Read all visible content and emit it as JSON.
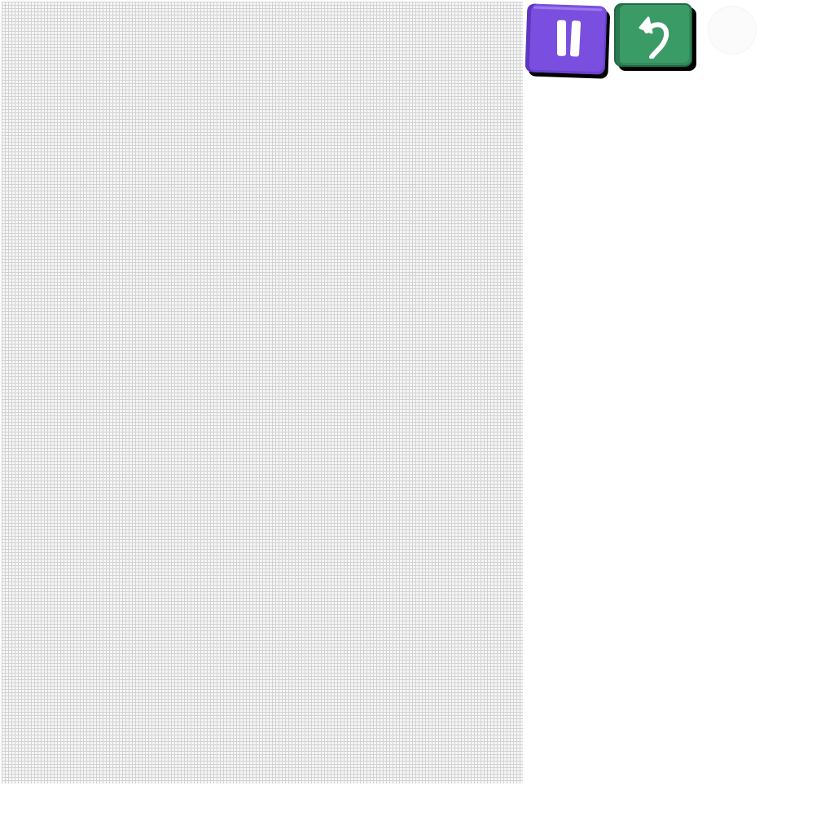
{
  "game": {
    "board": {
      "pattern": "grid",
      "background_color": "#f6f6f6",
      "line_color": "#d2d2d2"
    },
    "controls": {
      "pause": {
        "icon": "pause-icon",
        "color": "#7a4fe0"
      },
      "undo": {
        "icon": "undo-arrow-icon",
        "color": "#3a9b66"
      },
      "extra": {
        "icon": "faded-circle-icon",
        "color": "#fbfbfb"
      }
    }
  }
}
